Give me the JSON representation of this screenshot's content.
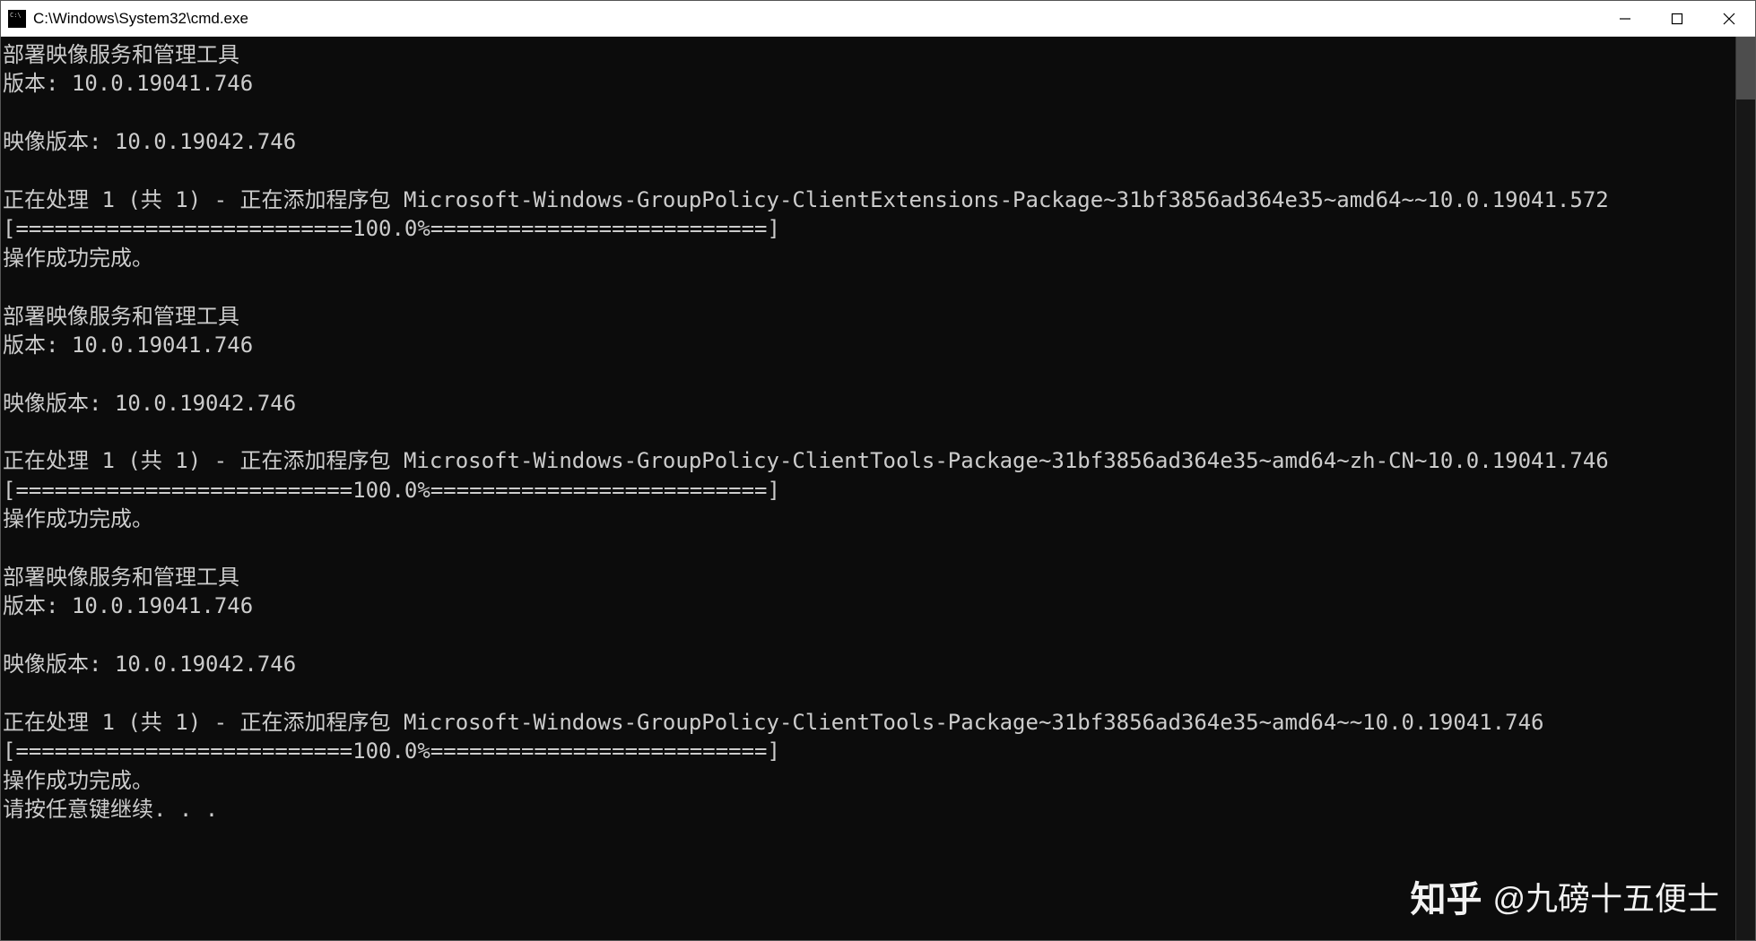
{
  "window": {
    "title": "C:\\Windows\\System32\\cmd.exe"
  },
  "terminal": {
    "lines": [
      "部署映像服务和管理工具",
      "版本: 10.0.19041.746",
      "",
      "映像版本: 10.0.19042.746",
      "",
      "正在处理 1 (共 1) - 正在添加程序包 Microsoft-Windows-GroupPolicy-ClientExtensions-Package~31bf3856ad364e35~amd64~~10.0.19041.572",
      "[==========================100.0%==========================]",
      "操作成功完成。",
      "",
      "部署映像服务和管理工具",
      "版本: 10.0.19041.746",
      "",
      "映像版本: 10.0.19042.746",
      "",
      "正在处理 1 (共 1) - 正在添加程序包 Microsoft-Windows-GroupPolicy-ClientTools-Package~31bf3856ad364e35~amd64~zh-CN~10.0.19041.746",
      "[==========================100.0%==========================]",
      "操作成功完成。",
      "",
      "部署映像服务和管理工具",
      "版本: 10.0.19041.746",
      "",
      "映像版本: 10.0.19042.746",
      "",
      "正在处理 1 (共 1) - 正在添加程序包 Microsoft-Windows-GroupPolicy-ClientTools-Package~31bf3856ad364e35~amd64~~10.0.19041.746",
      "[==========================100.0%==========================]",
      "操作成功完成。",
      "请按任意键继续. . ."
    ]
  },
  "watermark": {
    "logo": "知乎",
    "text": "@九磅十五便士"
  }
}
